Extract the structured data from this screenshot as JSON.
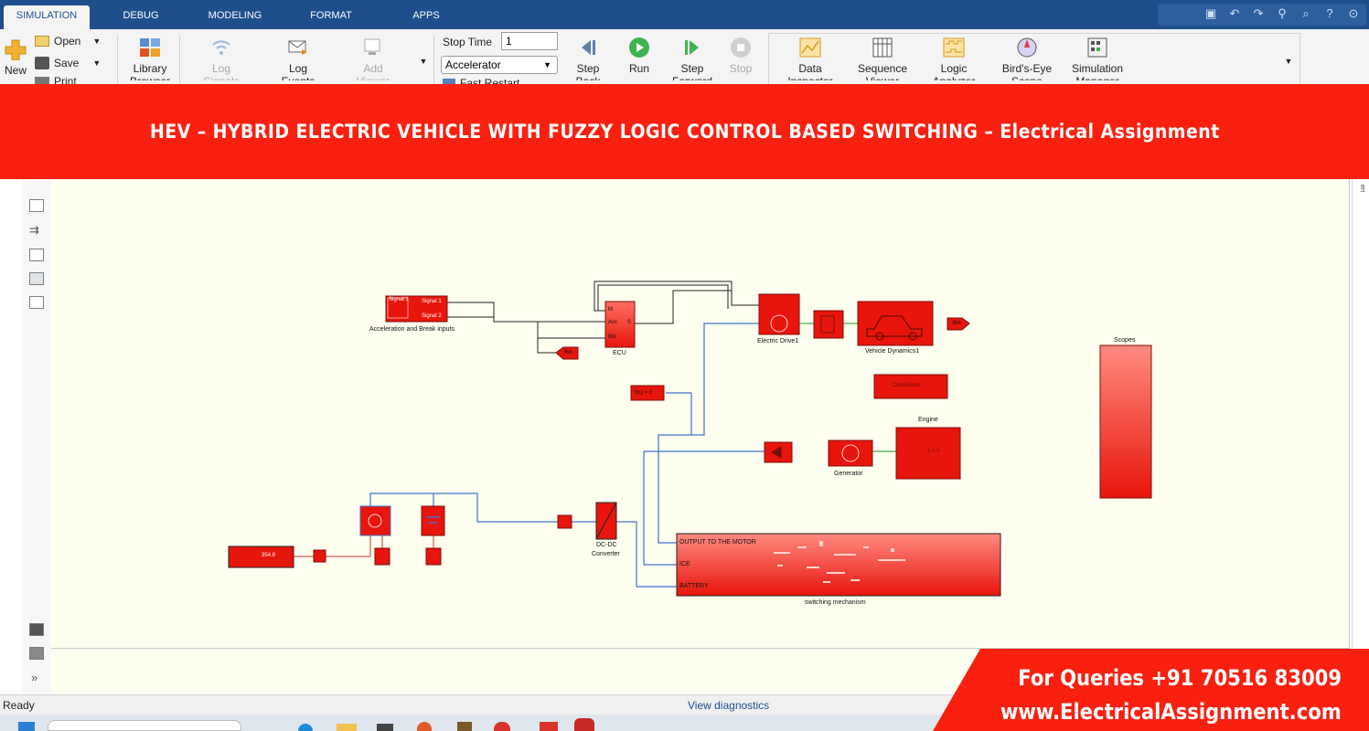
{
  "tabs": [
    {
      "label": "SIMULATION",
      "active": true
    },
    {
      "label": "DEBUG",
      "active": false
    },
    {
      "label": "MODELING",
      "active": false
    },
    {
      "label": "FORMAT",
      "active": false
    },
    {
      "label": "APPS",
      "active": false
    }
  ],
  "ribbon": {
    "new_label": "New",
    "open_label": "Open",
    "save_label": "Save",
    "print_label": "Print",
    "library_label_1": "Library",
    "library_label_2": "Browser",
    "log_signals_1": "Log",
    "log_signals_2": "Signals",
    "log_events_1": "Log",
    "log_events_2": "Events",
    "add_viewer_1": "Add",
    "add_viewer_2": "Viewer",
    "stop_time_label": "Stop Time",
    "stop_time_value": "1",
    "sim_mode": "Accelerator",
    "fast_restart": "Fast Restart",
    "step_back_1": "Step",
    "step_back_2": "Back",
    "run_label": "Run",
    "step_forward_1": "Step",
    "step_forward_2": "Forward",
    "stop_label": "Stop",
    "data_inspector_1": "Data",
    "data_inspector_2": "Inspector",
    "sequence_viewer_1": "Sequence",
    "sequence_viewer_2": "Viewer",
    "logic_analyzer_1": "Logic",
    "logic_analyzer_2": "Analyzer",
    "birds_eye_1": "Bird's-Eye",
    "birds_eye_2": "Scope",
    "sim_manager_1": "Simulation",
    "sim_manager_2": "Manager"
  },
  "banner": {
    "title": "HEV – HYBRID ELECTRIC VEHICLE WITH FUZZY LOGIC CONTROL BASED SWITCHING – Electrical Assignment"
  },
  "diagram": {
    "accel_block_top": "Signal 1",
    "accel_signal1": "Signal 1",
    "accel_signal2": "Signal 2",
    "accel_caption": "Acceleration and Break inputs",
    "ecu_in_m": "M",
    "ecu_in_acc": "Acc",
    "ecu_in_brk": "Brk",
    "ecu_out": "S",
    "ecu_caption": "ECU",
    "brk_goto": "Brk",
    "brk_from": "Brk",
    "electric_drive_caption": "Electric Drive1",
    "vehicle_dynamics_caption": "Vehicle Dynamics1",
    "continuous_label": "Continuous",
    "fx_label": "f(x) = 0",
    "engine_caption": "Engine",
    "engine_inner": "? ? ?",
    "generator_caption": "Generator",
    "scopes_caption": "Scopes",
    "dcdc_caption_1": "DC-DC",
    "dcdc_caption_2": "Converter",
    "display_value": "354.8",
    "switch_port1": "OUTPUT TO THE MOTOR",
    "switch_port2": "ICE",
    "switch_port3": "BATTERY",
    "switch_caption": "switching mechanism"
  },
  "status": {
    "ready": "Ready",
    "view_diagnostics": "View diagnostics"
  },
  "promo": {
    "line1": "For Queries +91 70516 83009",
    "line2": "www.ElectricalAssignment.com"
  },
  "right_edge_label": "ert",
  "colors": {
    "tab_bar": "#1f4e8c",
    "banner_red": "#fa2010",
    "block_red": "#e8150c",
    "canvas": "#fffff0",
    "wire_blue": "#3f72c8",
    "wire_green": "#3aa84a"
  }
}
